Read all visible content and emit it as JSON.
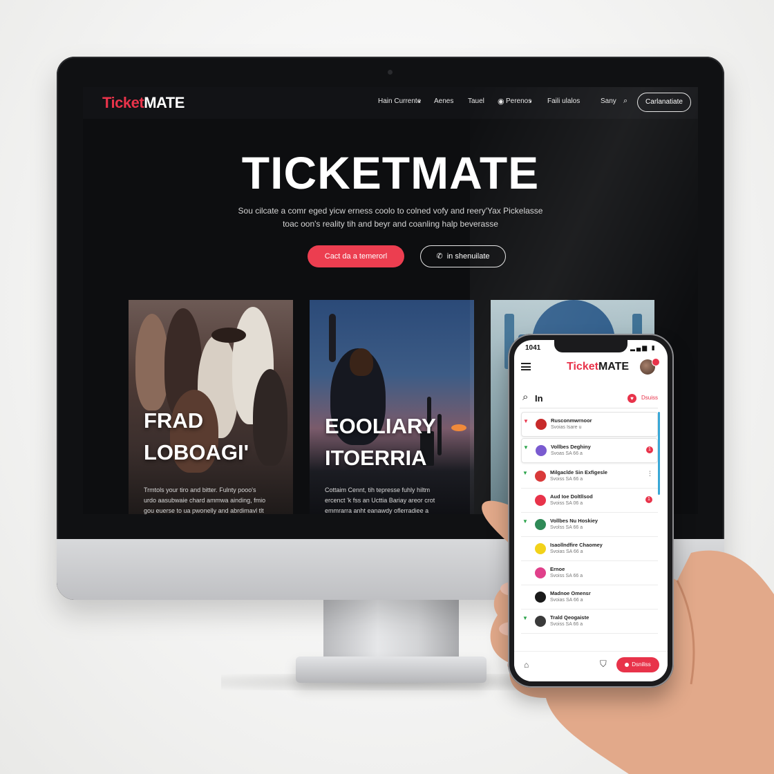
{
  "site": {
    "logo_part1": "Ticket",
    "logo_part2": "MATE",
    "nav": [
      "Hain Currente",
      "Aenes",
      "Tauel",
      "Perenos",
      "Faili ulalos",
      "Sany"
    ],
    "nav_cta": "Carlanatiate",
    "hero_title": "TICKETMATE",
    "hero_sub_line1": "Sou cilcate a comr eged yicw erness coolo to colned vofy and reery'Yax Pickelasse",
    "hero_sub_line2": "toac oon's reality tih and beyr and coanling halp beverasse",
    "primary_button": "Cact da a temerorl",
    "secondary_button": "in shenuilate",
    "cards": [
      {
        "title_line1": "FRAD",
        "title_line2": "LOBOAGI'",
        "desc_line1": "Trmtols your tiro and bitter. Fulnty pooo's",
        "desc_line2": "urdo aasubwaie chard ammwa ainding, fmio",
        "desc_line3": "gou euerse to ua pwonelly and abrdimavl tlt"
      },
      {
        "title_line1": "EOOLIARY",
        "title_line2": "ITOERRIA",
        "desc_line1": "Cottaim Cennt, tih tepresse fuhly hiltm",
        "desc_line2": "ercenct 'k fss an Ucttia Bariay areor crot",
        "desc_line3": "emmrarra anht eanawdy oflerradiee a"
      },
      {
        "title_line1": "",
        "title_line2": "",
        "desc_line1": "",
        "desc_line2": "",
        "desc_line3": ""
      }
    ]
  },
  "app": {
    "status_time": "1041",
    "logo_part1": "Ticket",
    "logo_part2": "MATE",
    "search_text": "In",
    "filter_label": "Dsuiss",
    "list": [
      {
        "title": "Rusconmwrnoor",
        "sub": "Svoias Isare u",
        "icon_color": "#c72a2a",
        "check": "red",
        "badge": ""
      },
      {
        "title": "Vollbes Deghiny",
        "sub": "Svoas SA 66 a",
        "icon_color": "#7a5bd0",
        "check": "green",
        "badge": "1"
      },
      {
        "title": "Milgaclde Sin Exfigesle",
        "sub": "Svoiss SA 66 a",
        "icon_color": "#d93a3a",
        "check": "green",
        "badge": ""
      },
      {
        "title": "Aud Ioe Doltllsod",
        "sub": "Svoiss SA 06 a",
        "icon_color": "#e8334a",
        "check": "",
        "badge": "1"
      },
      {
        "title": "Vollbes Nu Hoskiey",
        "sub": "Svolss SA 66 a",
        "icon_color": "#2f8a57",
        "check": "green",
        "badge": ""
      },
      {
        "title": "Isaollndfire Chaomey",
        "sub": "Svoias SA 66 a",
        "icon_color": "#f2d21a",
        "check": "",
        "badge": ""
      },
      {
        "title": "Ernoe",
        "sub": "Svoiss SA 66 a",
        "icon_color": "#e0408a",
        "check": "",
        "badge": ""
      },
      {
        "title": "Madnoe Omensr",
        "sub": "Svoias SA 66 a",
        "icon_color": "#1a1a1a",
        "check": "",
        "badge": ""
      },
      {
        "title": "Trald Qeogaiste",
        "sub": "Svoiss SA 66 a",
        "icon_color": "#3a3a3a",
        "check": "green",
        "badge": ""
      }
    ],
    "tab_cta": "Dsniliss"
  },
  "colors": {
    "accent": "#e8334a",
    "screen_bg": "#0d0e10",
    "phone_bg": "#ffffff"
  },
  "icons": {
    "phone_cta": "phone-icon",
    "search": "search-icon",
    "menu": "menu-icon",
    "home": "home-icon",
    "shield": "shield-icon"
  }
}
